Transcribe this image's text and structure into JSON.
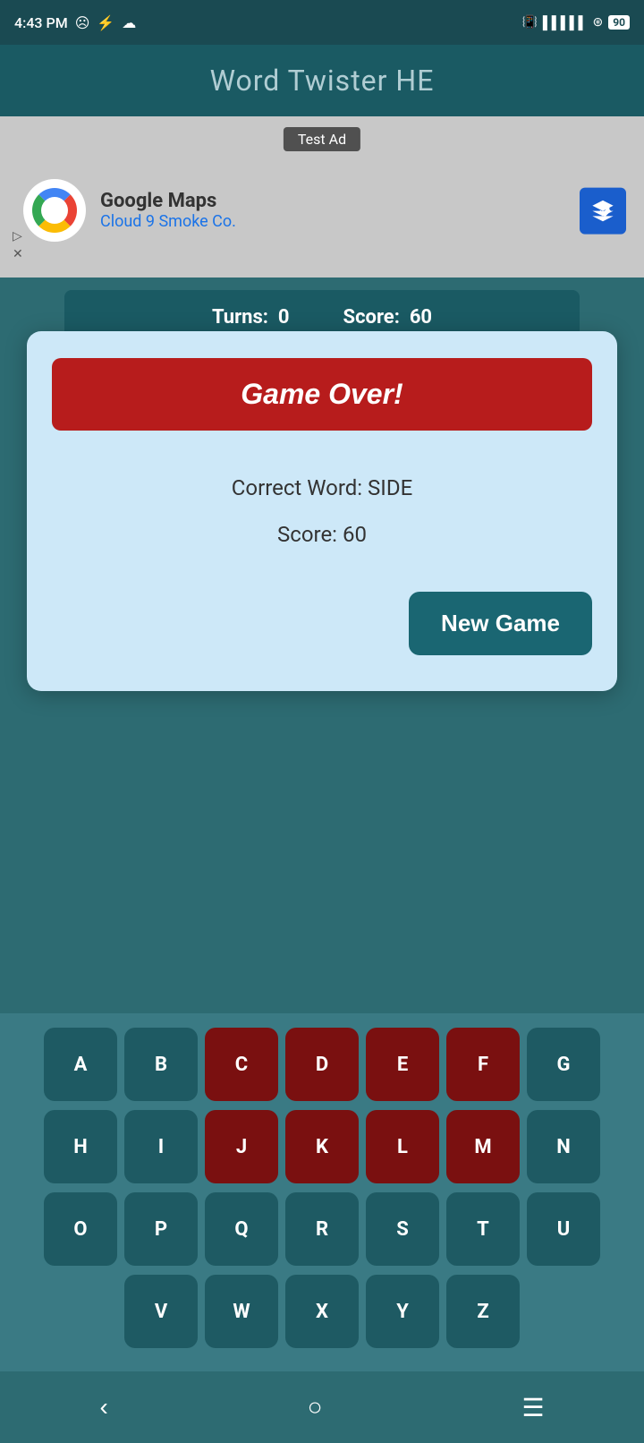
{
  "statusBar": {
    "time": "4:43 PM",
    "battery": "90"
  },
  "header": {
    "title": "Word Twister HE"
  },
  "ad": {
    "label": "Test Ad",
    "company": "Google Maps",
    "subtitle": "Cloud 9 Smoke Co."
  },
  "scoreBar": {
    "turnsLabel": "Turns:",
    "turnsValue": "0",
    "scoreLabel": "Score:",
    "scoreValue": "60"
  },
  "modal": {
    "gameOverLabel": "Game Over!",
    "correctWordLabel": "Correct Word: SIDE",
    "scoreLabel": "Score: 60",
    "newGameLabel": "New Game"
  },
  "keyboard": {
    "rows": [
      [
        "A",
        "B",
        "C",
        "D",
        "E",
        "F",
        "G"
      ],
      [
        "H",
        "I",
        "J",
        "K",
        "L",
        "M",
        "N"
      ],
      [
        "O",
        "P",
        "Q",
        "R",
        "S",
        "T",
        "U"
      ],
      [
        "V",
        "W",
        "X",
        "Y",
        "Z"
      ]
    ],
    "usedKeys": [
      "C",
      "D",
      "E",
      "F",
      "J",
      "K",
      "L",
      "M"
    ]
  },
  "bottomNav": {
    "back": "‹",
    "home": "○",
    "menu": "≡"
  }
}
